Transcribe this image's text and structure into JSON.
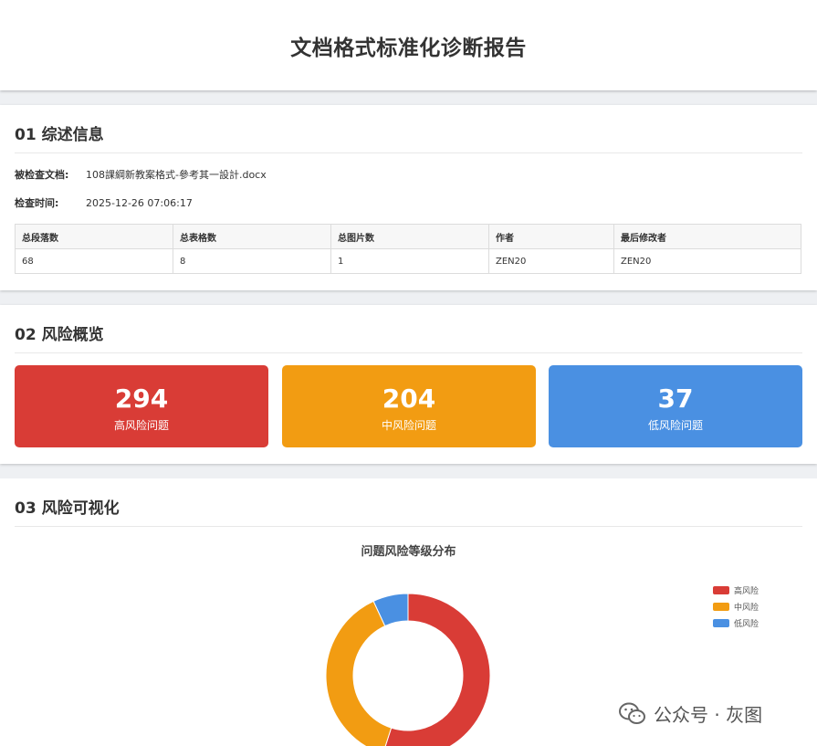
{
  "header": {
    "title": "文档格式标准化诊断报告"
  },
  "summary": {
    "title": "01 综述信息",
    "file_label": "被检查文档:",
    "file_value": "108課綱新教案格式-參考其一設計.docx",
    "time_label": "检查时间:",
    "time_value": "2025-12-26 07:06:17",
    "table": {
      "headers": [
        "总段落数",
        "总表格数",
        "总图片数",
        "作者",
        "最后修改者"
      ],
      "row": [
        "68",
        "8",
        "1",
        "ZEN20",
        "ZEN20"
      ]
    }
  },
  "overview": {
    "title": "02 风险概览",
    "high": {
      "value": "294",
      "label": "高风险问题",
      "color": "#d93c36"
    },
    "mid": {
      "value": "204",
      "label": "中风险问题",
      "color": "#f29c12"
    },
    "low": {
      "value": "37",
      "label": "低风险问题",
      "color": "#4a90e2"
    }
  },
  "visual": {
    "title": "03 风险可视化"
  },
  "chart_data": {
    "type": "pie",
    "title": "问题风险等级分布",
    "categories": [
      "高风险",
      "中风险",
      "低风险"
    ],
    "values": [
      294,
      204,
      37
    ],
    "colors": [
      "#d93c36",
      "#f29c12",
      "#4a90e2"
    ],
    "legend": "top-right"
  },
  "watermark": {
    "text": "公众号 · 灰图",
    "icon": "wechat-icon"
  }
}
